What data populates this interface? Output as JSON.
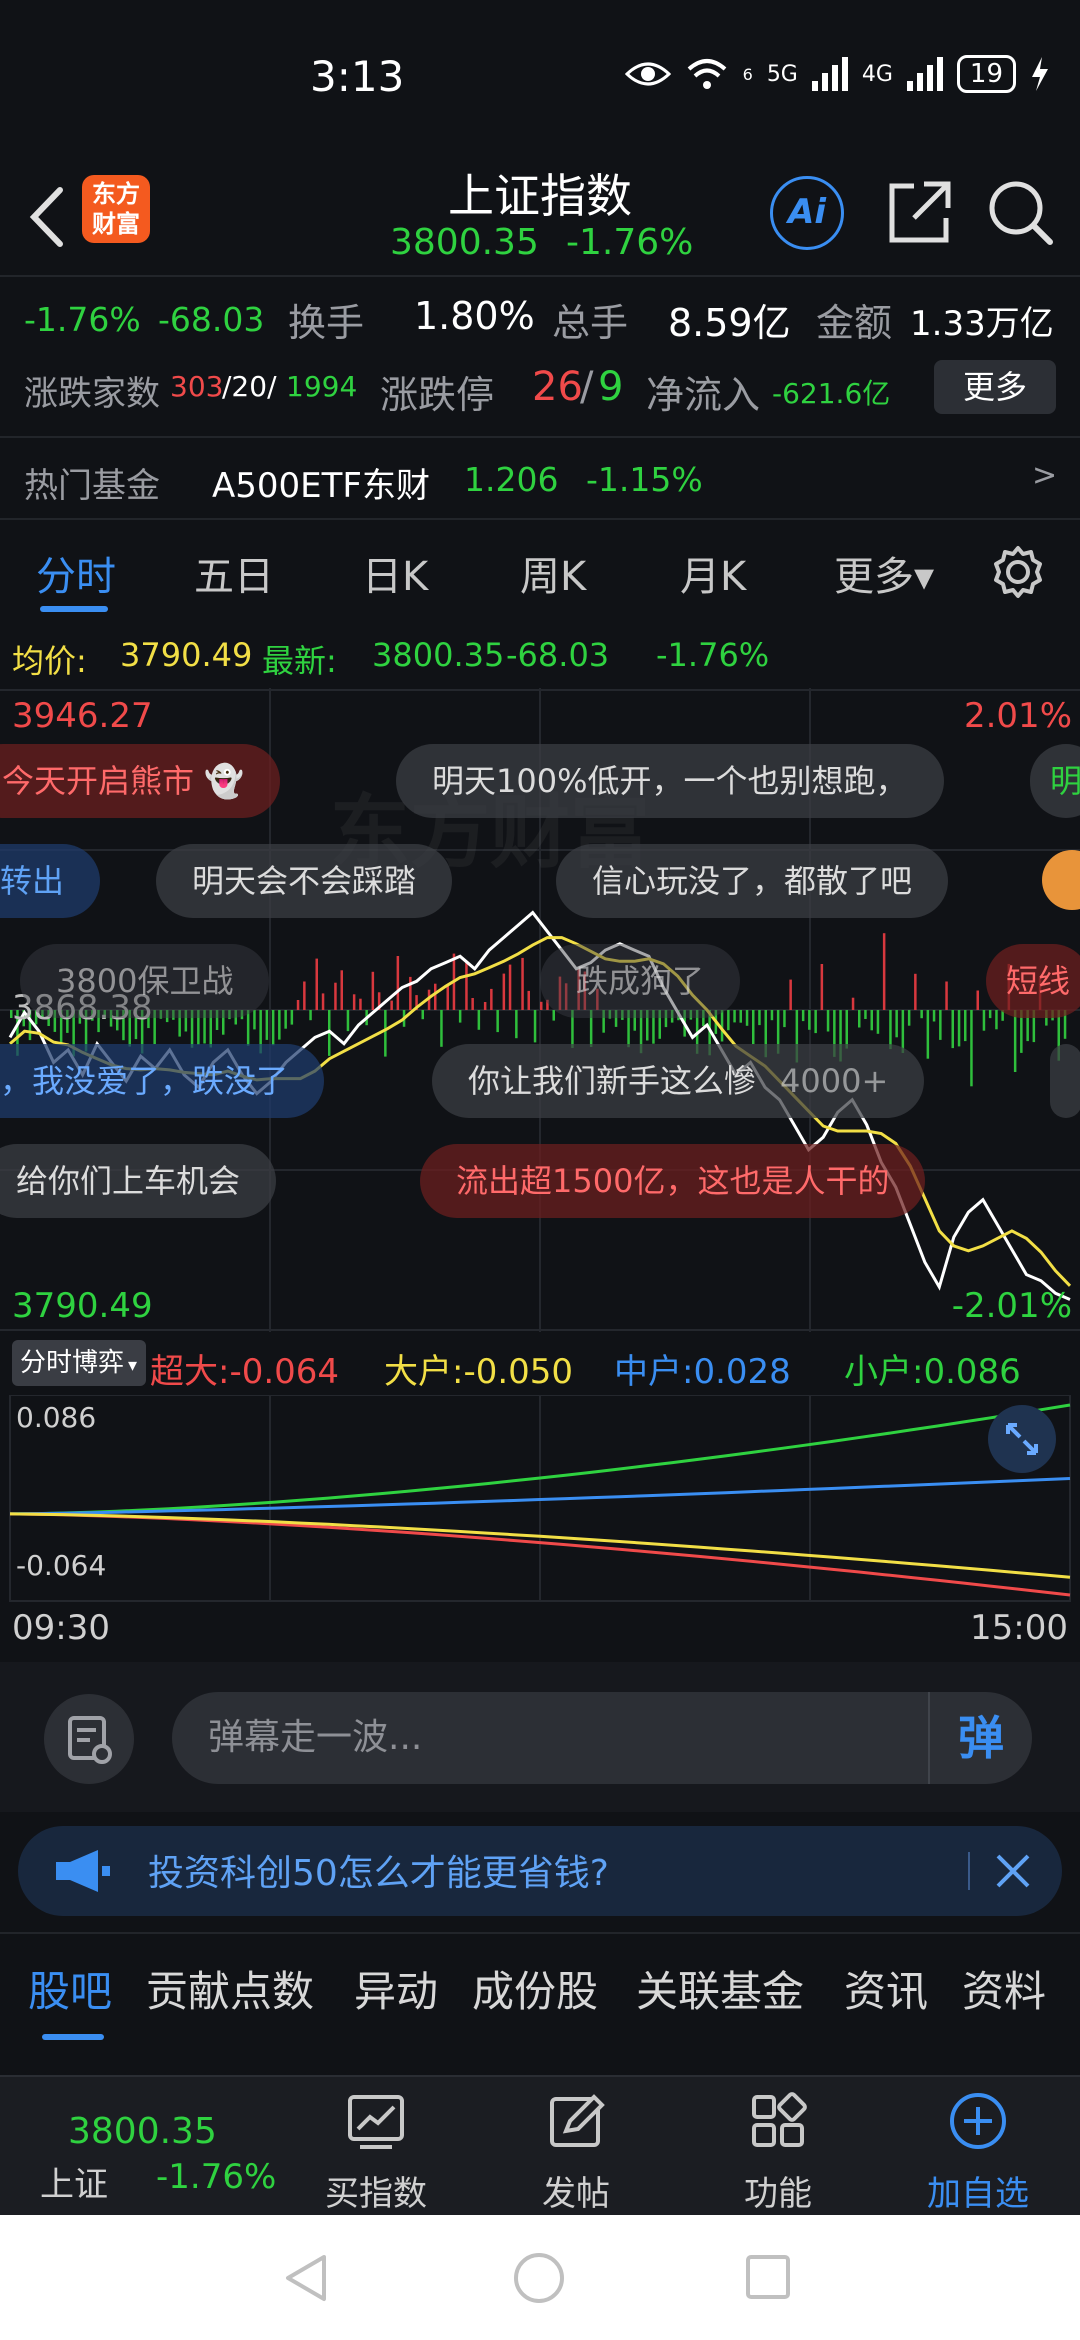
{
  "status_bar": {
    "time": "3:13",
    "network_labels": [
      "6",
      "5G",
      "4G"
    ],
    "battery": "19"
  },
  "header": {
    "logo_text": "东方财富",
    "title": "上证指数",
    "price": "3800.35",
    "change_pct": "-1.76%"
  },
  "stats": {
    "change_pct": "-1.76%",
    "change_val": "-68.03",
    "turnover_label": "换手",
    "turnover": "1.80%",
    "volume_label": "总手",
    "volume": "8.59亿",
    "amount_label": "金额",
    "amount": "1.33万亿",
    "breadth_label": "涨跌家数",
    "breadth_up": "303",
    "breadth_flat": "/20/",
    "breadth_down": "1994",
    "limit_label": "涨跌停",
    "limit_up": "26",
    "limit_sep": "/",
    "limit_down": "9",
    "net_flow_label": "净流入",
    "net_flow": "-621.6亿",
    "more_label": "更多"
  },
  "hot_fund": {
    "label": "热门基金",
    "name": "A500ETF东财",
    "price": "1.206",
    "change": "-1.15%",
    "arrow": ">"
  },
  "chart_tabs": [
    "分时",
    "五日",
    "日K",
    "周K",
    "月K",
    "更多▾"
  ],
  "avg_row": {
    "avg_label": "均价:",
    "avg": "3790.49",
    "latest_label": "最新:",
    "latest": "3800.35",
    "change_val": "-68.03",
    "change_pct": "-1.76%"
  },
  "main_chart": {
    "top_price": "3946.27",
    "top_pct": "2.01%",
    "mid_price": "3868.38",
    "bottom_price": "3790.49",
    "bottom_pct": "-2.01%",
    "watermark": "东方财富"
  },
  "danmaku": [
    "今天开启熊市",
    "明天100%低开，一个也别想跑，",
    "转出",
    "明天会不会踩踏",
    "信心玩没了，都散了吧",
    "3800保卫战",
    "跌成狗了",
    "短线",
    "，我没爱了，跌没了",
    "你让我们新手这么慘",
    "4000+",
    "给你们上车机会",
    "流出超1500亿，这也是人干的"
  ],
  "flow": {
    "select_label": "分时博弈",
    "super_label": "超大:-0.064",
    "large_label": "大户:-0.050",
    "medium_label": "中户:0.028",
    "small_label": "小户:0.086",
    "max": "0.086",
    "min": "-0.064",
    "time_start": "09:30",
    "time_end": "15:00"
  },
  "comment": {
    "placeholder": "弹幕走一波...",
    "send_label": "弹"
  },
  "promo": {
    "text": "投资科创50怎么才能更省钱?"
  },
  "content_tabs": [
    "股吧",
    "贡献点数",
    "异动",
    "成份股",
    "关联基金",
    "资讯",
    "资料"
  ],
  "bottom_nav": {
    "price": "3800.35",
    "name": "上证",
    "change": "-1.76%",
    "items": [
      "买指数",
      "发帖",
      "功能",
      "加自选"
    ]
  },
  "colors": {
    "up": "#f04a4a",
    "down": "#2fd240",
    "accent": "#3a8ef2",
    "avg_line": "#f2df46"
  }
}
